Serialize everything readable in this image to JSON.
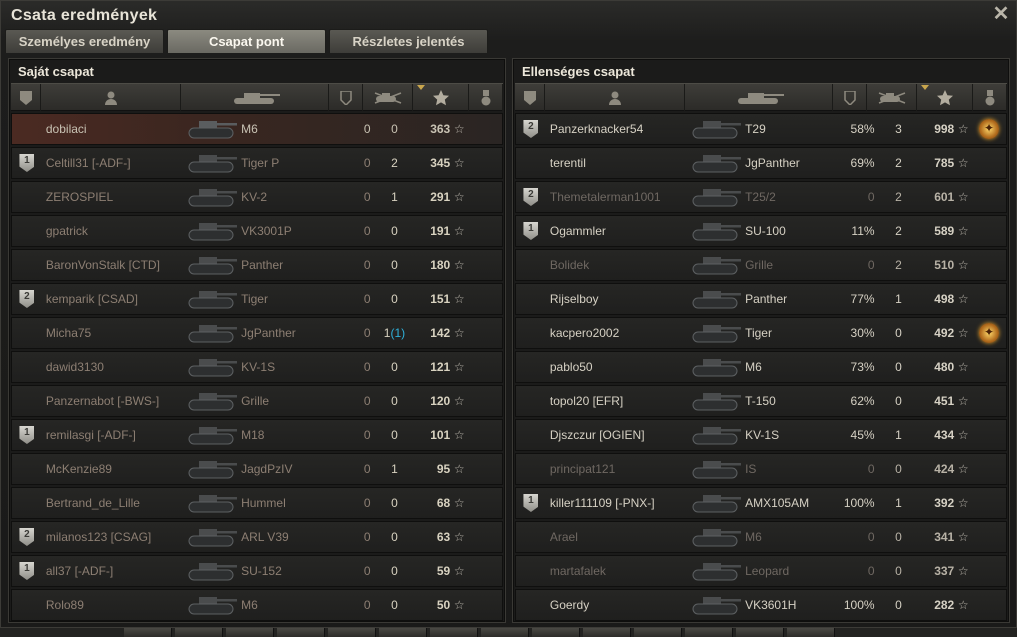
{
  "window": {
    "title": "Csata eredmények"
  },
  "tabs": [
    {
      "label": "Személyes eredmény",
      "active": false
    },
    {
      "label": "Csapat pont",
      "active": true
    },
    {
      "label": "Részletes jelentés",
      "active": false
    }
  ],
  "columns": [
    "badge-icon",
    "player-icon",
    "tank-icon",
    "shield-icon",
    "frags-icon",
    "star-icon",
    "medal-icon"
  ],
  "left_team": {
    "title": "Saját csapat",
    "rows": [
      {
        "badge": "",
        "name": "dobilaci",
        "vehicle": "M6",
        "pct": "0",
        "frags": "0",
        "xp": "363",
        "state": "mine",
        "medal": false
      },
      {
        "badge": "1",
        "name": "Celtill31 [-ADF-]",
        "vehicle": "Tiger P",
        "pct": "0",
        "frags": "2",
        "xp": "345",
        "state": "dead",
        "medal": false
      },
      {
        "badge": "",
        "name": "ZEROSPIEL",
        "vehicle": "KV-2",
        "pct": "0",
        "frags": "1",
        "xp": "291",
        "state": "dead",
        "medal": false
      },
      {
        "badge": "",
        "name": "gpatrick",
        "vehicle": "VK3001P",
        "pct": "0",
        "frags": "0",
        "xp": "191",
        "state": "dead",
        "medal": false
      },
      {
        "badge": "",
        "name": "BaronVonStalk [CTD]",
        "vehicle": "Panther",
        "pct": "0",
        "frags": "0",
        "xp": "180",
        "state": "dead",
        "medal": false
      },
      {
        "badge": "2",
        "name": "kemparik [CSAD]",
        "vehicle": "Tiger",
        "pct": "0",
        "frags": "0",
        "xp": "151",
        "state": "dead",
        "medal": false
      },
      {
        "badge": "",
        "name": "Micha75",
        "vehicle": "JgPanther",
        "pct": "0",
        "frags": "1",
        "frags_extra": "(1)",
        "xp": "142",
        "state": "dead",
        "medal": false
      },
      {
        "badge": "",
        "name": "dawid3130",
        "vehicle": "KV-1S",
        "pct": "0",
        "frags": "0",
        "xp": "121",
        "state": "dead",
        "medal": false
      },
      {
        "badge": "",
        "name": "Panzernabot [-BWS-]",
        "vehicle": "Grille",
        "pct": "0",
        "frags": "0",
        "xp": "120",
        "state": "dead",
        "medal": false
      },
      {
        "badge": "1",
        "name": "remilasgi [-ADF-]",
        "vehicle": "M18",
        "pct": "0",
        "frags": "0",
        "xp": "101",
        "state": "dead",
        "medal": false
      },
      {
        "badge": "",
        "name": "McKenzie89",
        "vehicle": "JagdPzIV",
        "pct": "0",
        "frags": "1",
        "xp": "95",
        "state": "dead",
        "medal": false
      },
      {
        "badge": "",
        "name": "Bertrand_de_Lille",
        "vehicle": "Hummel",
        "pct": "0",
        "frags": "0",
        "xp": "68",
        "state": "dead",
        "medal": false
      },
      {
        "badge": "2",
        "name": "milanos123 [CSAG]",
        "vehicle": "ARL V39",
        "pct": "0",
        "frags": "0",
        "xp": "63",
        "state": "dead",
        "medal": false
      },
      {
        "badge": "1",
        "name": "all37 [-ADF-]",
        "vehicle": "SU-152",
        "pct": "0",
        "frags": "0",
        "xp": "59",
        "state": "dead",
        "medal": false
      },
      {
        "badge": "",
        "name": "Rolo89",
        "vehicle": "M6",
        "pct": "0",
        "frags": "0",
        "xp": "50",
        "state": "dead",
        "medal": false
      }
    ]
  },
  "right_team": {
    "title": "Ellenséges csapat",
    "rows": [
      {
        "badge": "2",
        "name": "Panzerknacker54",
        "vehicle": "T29",
        "pct": "58%",
        "frags": "3",
        "xp": "998",
        "state": "alive",
        "medal": true
      },
      {
        "badge": "",
        "name": "terentil",
        "vehicle": "JgPanther",
        "pct": "69%",
        "frags": "2",
        "xp": "785",
        "state": "alive",
        "medal": false
      },
      {
        "badge": "2",
        "name": "Themetalerman1001",
        "vehicle": "T25/2",
        "pct": "0",
        "frags": "2",
        "xp": "601",
        "state": "dim",
        "medal": false
      },
      {
        "badge": "1",
        "name": "Ogammler",
        "vehicle": "SU-100",
        "pct": "11%",
        "frags": "2",
        "xp": "589",
        "state": "alive",
        "medal": false
      },
      {
        "badge": "",
        "name": "Bolidek",
        "vehicle": "Grille",
        "pct": "0",
        "frags": "2",
        "xp": "510",
        "state": "dim",
        "medal": false
      },
      {
        "badge": "",
        "name": "Rijselboy",
        "vehicle": "Panther",
        "pct": "77%",
        "frags": "1",
        "xp": "498",
        "state": "alive",
        "medal": false
      },
      {
        "badge": "",
        "name": "kacpero2002",
        "vehicle": "Tiger",
        "pct": "30%",
        "frags": "0",
        "xp": "492",
        "state": "alive",
        "medal": true
      },
      {
        "badge": "",
        "name": "pablo50",
        "vehicle": "M6",
        "pct": "73%",
        "frags": "0",
        "xp": "480",
        "state": "alive",
        "medal": false
      },
      {
        "badge": "",
        "name": "topol20 [EFR]",
        "vehicle": "T-150",
        "pct": "62%",
        "frags": "0",
        "xp": "451",
        "state": "alive",
        "medal": false
      },
      {
        "badge": "",
        "name": "Djszczur [OGIEN]",
        "vehicle": "KV-1S",
        "pct": "45%",
        "frags": "1",
        "xp": "434",
        "state": "alive",
        "medal": false
      },
      {
        "badge": "",
        "name": "principat121",
        "vehicle": "IS",
        "pct": "0",
        "frags": "0",
        "xp": "424",
        "state": "dim",
        "medal": false
      },
      {
        "badge": "1",
        "name": "killer111109 [-PNX-]",
        "vehicle": "AMX105AM",
        "pct": "100%",
        "frags": "1",
        "xp": "392",
        "state": "alive",
        "medal": false
      },
      {
        "badge": "",
        "name": "Arael",
        "vehicle": "M6",
        "pct": "0",
        "frags": "0",
        "xp": "341",
        "state": "dim",
        "medal": false
      },
      {
        "badge": "",
        "name": "martafalek",
        "vehicle": "Leopard",
        "pct": "0",
        "frags": "0",
        "xp": "337",
        "state": "dim",
        "medal": false
      },
      {
        "badge": "",
        "name": "Goerdy",
        "vehicle": "VK3601H",
        "pct": "100%",
        "frags": "0",
        "xp": "282",
        "state": "alive",
        "medal": false
      }
    ]
  },
  "star_glyph": "☆"
}
